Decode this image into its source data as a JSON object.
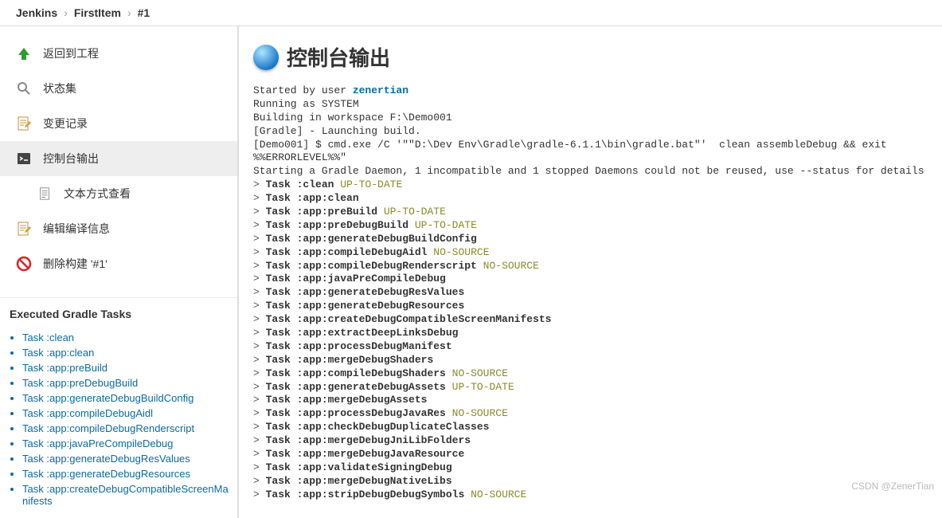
{
  "breadcrumb": {
    "items": [
      "Jenkins",
      "FirstItem",
      "#1"
    ]
  },
  "sidebar": {
    "nav": [
      {
        "label": "返回到工程",
        "icon": "up-arrow-icon",
        "icon_color": "#2e9e2e"
      },
      {
        "label": "状态集",
        "icon": "search-icon",
        "icon_color": "#888"
      },
      {
        "label": "变更记录",
        "icon": "doc-pencil-icon",
        "icon_color": "#c09040"
      },
      {
        "label": "控制台输出",
        "icon": "terminal-icon",
        "icon_color": "#444",
        "selected": true,
        "children": [
          {
            "label": "文本方式查看",
            "icon": "doc-icon",
            "icon_color": "#888"
          }
        ]
      },
      {
        "label": "编辑编译信息",
        "icon": "doc-pencil-icon",
        "icon_color": "#c09040"
      },
      {
        "label": "删除构建 '#1'",
        "icon": "no-entry-icon",
        "icon_color": "#d22"
      }
    ],
    "section_title": "Executed Gradle Tasks",
    "tasks": [
      "Task :clean",
      "Task :app:clean",
      "Task :app:preBuild",
      "Task :app:preDebugBuild",
      "Task :app:generateDebugBuildConfig",
      "Task :app:compileDebugAidl",
      "Task :app:compileDebugRenderscript",
      "Task :app:javaPreCompileDebug",
      "Task :app:generateDebugResValues",
      "Task :app:generateDebugResources",
      "Task :app:createDebugCompatibleScreenManifests"
    ]
  },
  "main": {
    "title": "控制台输出",
    "header_lines": {
      "started_prefix": "Started by user ",
      "started_user": "zenertian",
      "running": "Running as SYSTEM",
      "building": "Building in workspace F:\\Demo001",
      "gradle_launch": "[Gradle] - Launching build.",
      "cmd": "[Demo001] $ cmd.exe /C '\"\"D:\\Dev Env\\Gradle\\gradle-6.1.1\\bin\\gradle.bat\"'  clean assembleDebug && exit %%ERRORLEVEL%%\"",
      "daemon": "Starting a Gradle Daemon, 1 incompatible and 1 stopped Daemons could not be reused, use --status for details"
    },
    "console_tasks": [
      {
        "name": ":clean",
        "status": "UP-TO-DATE"
      },
      {
        "name": ":app:clean",
        "status": null
      },
      {
        "name": ":app:preBuild",
        "status": "UP-TO-DATE"
      },
      {
        "name": ":app:preDebugBuild",
        "status": "UP-TO-DATE"
      },
      {
        "name": ":app:generateDebugBuildConfig",
        "status": null
      },
      {
        "name": ":app:compileDebugAidl",
        "status": "NO-SOURCE"
      },
      {
        "name": ":app:compileDebugRenderscript",
        "status": "NO-SOURCE"
      },
      {
        "name": ":app:javaPreCompileDebug",
        "status": null
      },
      {
        "name": ":app:generateDebugResValues",
        "status": null
      },
      {
        "name": ":app:generateDebugResources",
        "status": null
      },
      {
        "name": ":app:createDebugCompatibleScreenManifests",
        "status": null
      },
      {
        "name": ":app:extractDeepLinksDebug",
        "status": null
      },
      {
        "name": ":app:processDebugManifest",
        "status": null
      },
      {
        "name": ":app:mergeDebugShaders",
        "status": null
      },
      {
        "name": ":app:compileDebugShaders",
        "status": "NO-SOURCE"
      },
      {
        "name": ":app:generateDebugAssets",
        "status": "UP-TO-DATE"
      },
      {
        "name": ":app:mergeDebugAssets",
        "status": null
      },
      {
        "name": ":app:processDebugJavaRes",
        "status": "NO-SOURCE"
      },
      {
        "name": ":app:checkDebugDuplicateClasses",
        "status": null
      },
      {
        "name": ":app:mergeDebugJniLibFolders",
        "status": null
      },
      {
        "name": ":app:mergeDebugJavaResource",
        "status": null
      },
      {
        "name": ":app:validateSigningDebug",
        "status": null
      },
      {
        "name": ":app:mergeDebugNativeLibs",
        "status": null
      },
      {
        "name": ":app:stripDebugDebugSymbols",
        "status": "NO-SOURCE"
      }
    ]
  },
  "watermark": "CSDN @ZenerTian"
}
